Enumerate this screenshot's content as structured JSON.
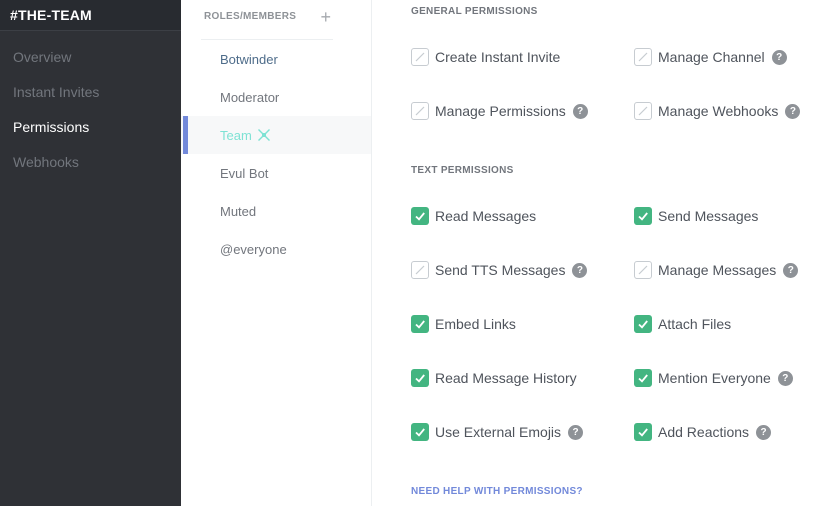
{
  "sidebar": {
    "channel_title": "#THE-TEAM",
    "items": [
      {
        "label": "Overview",
        "active": false
      },
      {
        "label": "Instant Invites",
        "active": false
      },
      {
        "label": "Permissions",
        "active": true
      },
      {
        "label": "Webhooks",
        "active": false
      }
    ]
  },
  "roles": {
    "header": "ROLES/MEMBERS",
    "add_icon": "plus-icon",
    "items": [
      {
        "label": "Botwinder"
      },
      {
        "label": "Moderator"
      },
      {
        "label": "Team",
        "selected": true,
        "badge_icon": "role-badge-icon"
      },
      {
        "label": "Evul Bot"
      },
      {
        "label": "Muted"
      },
      {
        "label": "@everyone"
      }
    ]
  },
  "permissions": {
    "general_title": "GENERAL PERMISSIONS",
    "general": [
      {
        "label": "Create Instant Invite",
        "checked": false,
        "help": false
      },
      {
        "label": "Manage Channel",
        "checked": false,
        "help": true
      },
      {
        "label": "Manage Permissions",
        "checked": false,
        "help": true
      },
      {
        "label": "Manage Webhooks",
        "checked": false,
        "help": true
      }
    ],
    "text_title": "TEXT PERMISSIONS",
    "text": [
      {
        "label": "Read Messages",
        "checked": true,
        "help": false
      },
      {
        "label": "Send Messages",
        "checked": true,
        "help": false
      },
      {
        "label": "Send TTS Messages",
        "checked": false,
        "help": true
      },
      {
        "label": "Manage Messages",
        "checked": false,
        "help": true
      },
      {
        "label": "Embed Links",
        "checked": true,
        "help": false
      },
      {
        "label": "Attach Files",
        "checked": true,
        "help": false
      },
      {
        "label": "Read Message History",
        "checked": true,
        "help": false
      },
      {
        "label": "Mention Everyone",
        "checked": true,
        "help": true
      },
      {
        "label": "Use External Emojis",
        "checked": true,
        "help": true
      },
      {
        "label": "Add Reactions",
        "checked": true,
        "help": true
      }
    ],
    "help_question": "?",
    "help_link": "NEED HELP WITH PERMISSIONS?"
  },
  "colors": {
    "checked": "#43b581",
    "accent": "#7289da",
    "selected_role": "#7ee2d4"
  }
}
